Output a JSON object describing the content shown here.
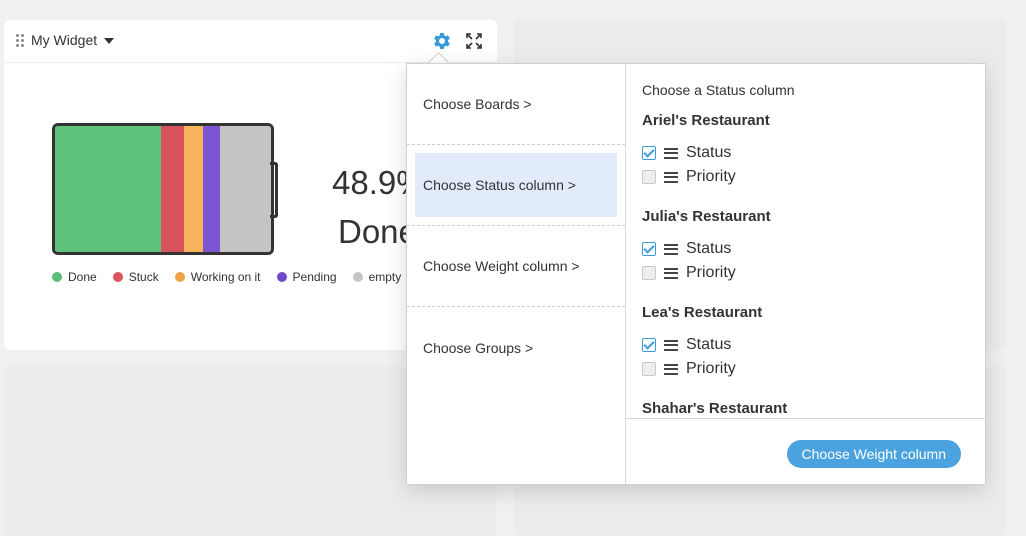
{
  "widget": {
    "title": "My Widget",
    "percentage": "48.9%",
    "status_label": "Done",
    "battery": [
      {
        "name": "Done",
        "fraction": 0.489,
        "color": "#5dc27a"
      },
      {
        "name": "Stuck",
        "fraction": 0.107,
        "color": "#d9535e"
      },
      {
        "name": "Working on it",
        "fraction": 0.087,
        "color": "#f5b35b"
      },
      {
        "name": "Pending",
        "fraction": 0.083,
        "color": "#7b55d2"
      },
      {
        "name": "empty",
        "fraction": 0.234,
        "color": "#c4c4c4"
      }
    ],
    "legend": [
      {
        "label": "Done",
        "color": "#5cbd79"
      },
      {
        "label": "Stuck",
        "color": "#d9535e"
      },
      {
        "label": "Working on it",
        "color": "#f0a245"
      },
      {
        "label": "Pending",
        "color": "#7148cc"
      },
      {
        "label": "empty",
        "color": "#c4c4c4"
      }
    ],
    "icons": {
      "drag": "drag-handle-icon",
      "caret": "caret-down-icon",
      "settings": "gear-icon",
      "expand": "expand-icon"
    }
  },
  "settings_menu": {
    "items": [
      {
        "label": "Choose Boards >",
        "active": false
      },
      {
        "label": "Choose Status column >",
        "active": true
      },
      {
        "label": "Choose Weight column >",
        "active": false
      },
      {
        "label": "Choose Groups >",
        "active": false
      }
    ]
  },
  "status_panel": {
    "heading": "Choose a Status column",
    "boards": [
      {
        "name": "Ariel's Restaurant",
        "columns": [
          {
            "label": "Status",
            "checked": true
          },
          {
            "label": "Priority",
            "checked": false
          }
        ]
      },
      {
        "name": "Julia's Restaurant",
        "columns": [
          {
            "label": "Status",
            "checked": true
          },
          {
            "label": "Priority",
            "checked": false
          }
        ]
      },
      {
        "name": "Lea's Restaurant",
        "columns": [
          {
            "label": "Status",
            "checked": true
          },
          {
            "label": "Priority",
            "checked": false
          }
        ]
      },
      {
        "name": "Shahar's Restaurant",
        "columns": []
      }
    ],
    "next_button": "Choose Weight column"
  },
  "colors": {
    "accent": "#4aa3df",
    "highlight": "#e2ebfa"
  }
}
